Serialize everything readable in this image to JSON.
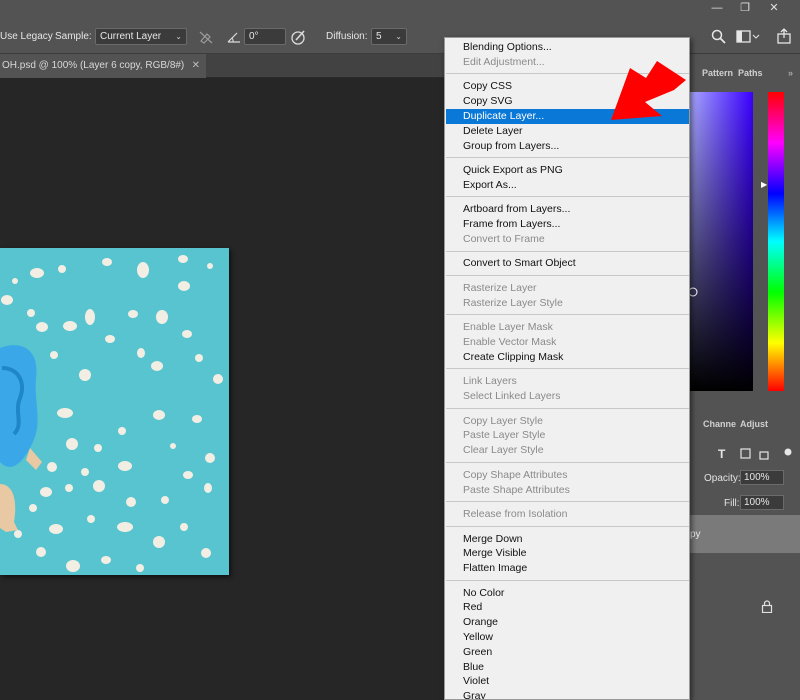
{
  "options_bar": {
    "use_legacy": "Use Legacy",
    "sample_label": "Sample:",
    "sample_value": "Current Layer",
    "angle_value": "0°",
    "diffusion_label": "Diffusion:",
    "diffusion_value": "5"
  },
  "document_tab": {
    "title": "OH.psd @ 100% (Layer 6 copy, RGB/8#)"
  },
  "panels": {
    "tabs_top": [
      "Pattern",
      "Paths"
    ],
    "tabs_mid": [
      "Channe",
      "Adjust"
    ],
    "opacity_label": "Opacity:",
    "opacity_value": "100%",
    "fill_label": "Fill:",
    "fill_value": "100%",
    "layer_name_fragment": "py"
  },
  "context_menu": {
    "groups": [
      [
        {
          "label": "Blending Options...",
          "disabled": false
        },
        {
          "label": "Edit Adjustment...",
          "disabled": true
        }
      ],
      [
        {
          "label": "Copy CSS",
          "disabled": false
        },
        {
          "label": "Copy SVG",
          "disabled": false
        },
        {
          "label": "Duplicate Layer...",
          "disabled": false,
          "highlighted": true
        },
        {
          "label": "Delete Layer",
          "disabled": false
        },
        {
          "label": "Group from Layers...",
          "disabled": false
        }
      ],
      [
        {
          "label": "Quick Export as PNG",
          "disabled": false
        },
        {
          "label": "Export As...",
          "disabled": false
        }
      ],
      [
        {
          "label": "Artboard from Layers...",
          "disabled": false
        },
        {
          "label": "Frame from Layers...",
          "disabled": false
        },
        {
          "label": "Convert to Frame",
          "disabled": true
        }
      ],
      [
        {
          "label": "Convert to Smart Object",
          "disabled": false
        }
      ],
      [
        {
          "label": "Rasterize Layer",
          "disabled": true
        },
        {
          "label": "Rasterize Layer Style",
          "disabled": true
        }
      ],
      [
        {
          "label": "Enable Layer Mask",
          "disabled": true
        },
        {
          "label": "Enable Vector Mask",
          "disabled": true
        },
        {
          "label": "Create Clipping Mask",
          "disabled": false
        }
      ],
      [
        {
          "label": "Link Layers",
          "disabled": true
        },
        {
          "label": "Select Linked Layers",
          "disabled": true
        }
      ],
      [
        {
          "label": "Copy Layer Style",
          "disabled": true
        },
        {
          "label": "Paste Layer Style",
          "disabled": true
        },
        {
          "label": "Clear Layer Style",
          "disabled": true
        }
      ],
      [
        {
          "label": "Copy Shape Attributes",
          "disabled": true
        },
        {
          "label": "Paste Shape Attributes",
          "disabled": true
        }
      ],
      [
        {
          "label": "Release from Isolation",
          "disabled": true
        }
      ],
      [
        {
          "label": "Merge Down",
          "disabled": false
        },
        {
          "label": "Merge Visible",
          "disabled": false
        },
        {
          "label": "Flatten Image",
          "disabled": false
        }
      ],
      [
        {
          "label": "No Color",
          "disabled": false
        },
        {
          "label": "Red",
          "disabled": false
        },
        {
          "label": "Orange",
          "disabled": false
        },
        {
          "label": "Yellow",
          "disabled": false
        },
        {
          "label": "Green",
          "disabled": false
        },
        {
          "label": "Blue",
          "disabled": false
        },
        {
          "label": "Violet",
          "disabled": false
        },
        {
          "label": "Gray",
          "disabled": false
        }
      ]
    ]
  },
  "colors": {
    "highlight": "#0a78d7",
    "annotation_arrow": "#ff0000",
    "photo_background": "#57c4cf"
  },
  "icons": [
    "minimize-icon",
    "restore-icon",
    "close-icon",
    "search-icon",
    "workspace-icon",
    "share-icon",
    "brush-off-icon",
    "angle-icon",
    "pressure-icon",
    "type-icon",
    "transform-icon",
    "lock-icon"
  ]
}
